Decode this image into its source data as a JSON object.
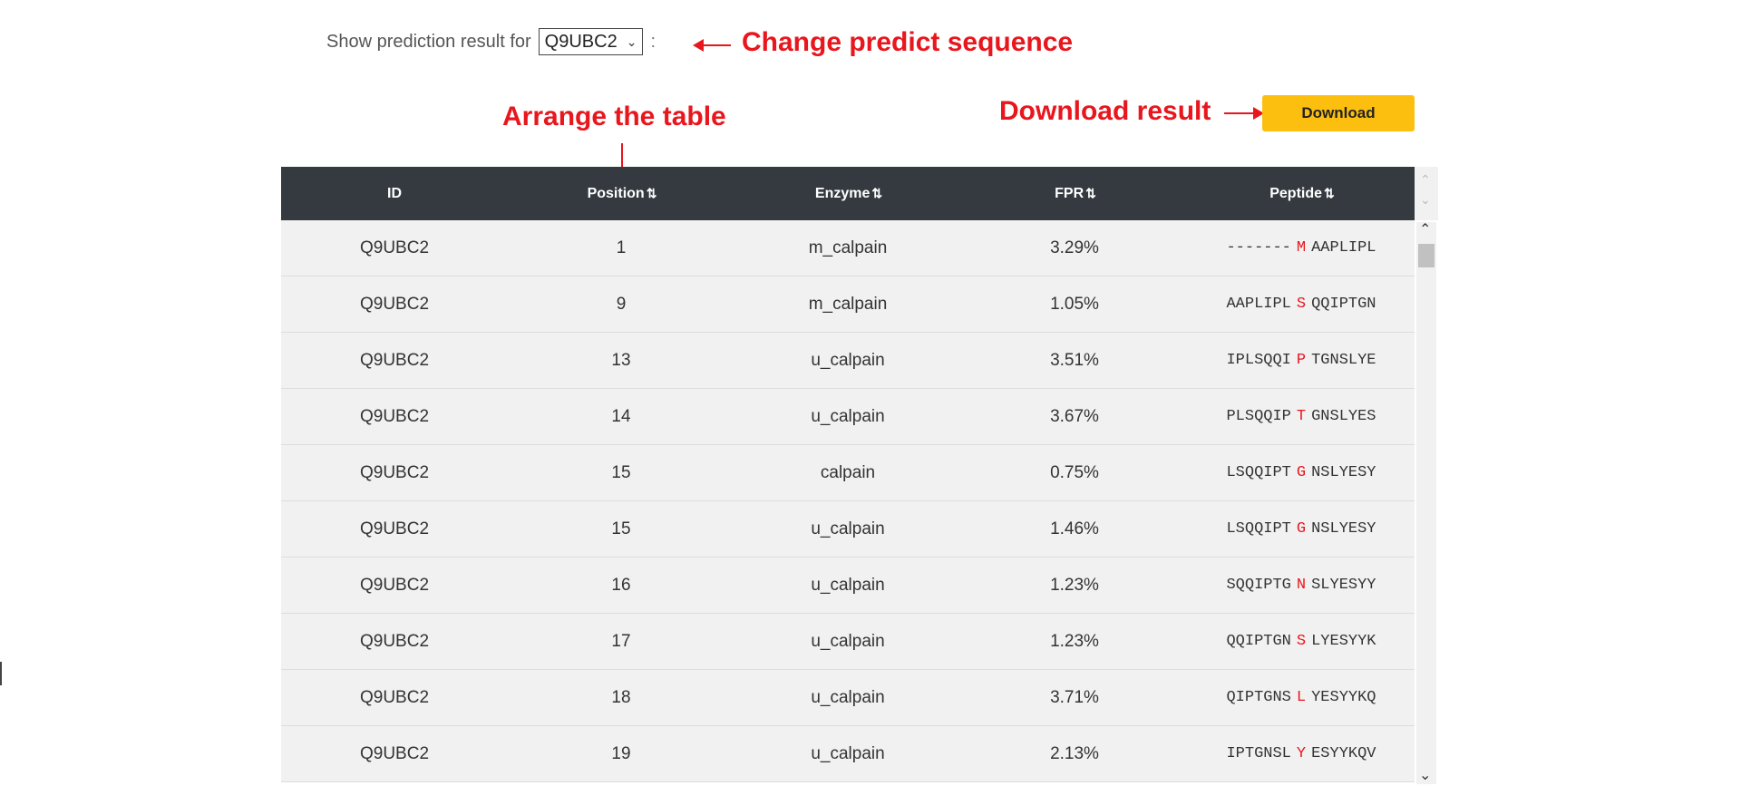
{
  "selector": {
    "label": "Show prediction result for",
    "value": "Q9UBC2",
    "colon": ":"
  },
  "annotations": {
    "change_sequence": "Change predict sequence",
    "arrange_table": "Arrange the table",
    "download_result": "Download result"
  },
  "download_button": {
    "label": "Download",
    "color": "#fdbf0f"
  },
  "table": {
    "headers": [
      {
        "label": "ID",
        "sortable": false
      },
      {
        "label": "Position",
        "sortable": true
      },
      {
        "label": "Enzyme",
        "sortable": true
      },
      {
        "label": "FPR",
        "sortable": true
      },
      {
        "label": "Peptide",
        "sortable": true
      }
    ],
    "sort_icon": "⇅",
    "rows": [
      {
        "id": "Q9UBC2",
        "position": "1",
        "enzyme": "m_calpain",
        "fpr": "3.29%",
        "pep_pre": "-------",
        "pep_site": "M",
        "pep_post": "AAPLIPL"
      },
      {
        "id": "Q9UBC2",
        "position": "9",
        "enzyme": "m_calpain",
        "fpr": "1.05%",
        "pep_pre": "AAPLIPL",
        "pep_site": "S",
        "pep_post": "QQIPTGN"
      },
      {
        "id": "Q9UBC2",
        "position": "13",
        "enzyme": "u_calpain",
        "fpr": "3.51%",
        "pep_pre": "IPLSQQI",
        "pep_site": "P",
        "pep_post": "TGNSLYE"
      },
      {
        "id": "Q9UBC2",
        "position": "14",
        "enzyme": "u_calpain",
        "fpr": "3.67%",
        "pep_pre": "PLSQQIP",
        "pep_site": "T",
        "pep_post": "GNSLYES"
      },
      {
        "id": "Q9UBC2",
        "position": "15",
        "enzyme": "calpain",
        "fpr": "0.75%",
        "pep_pre": "LSQQIPT",
        "pep_site": "G",
        "pep_post": "NSLYESY"
      },
      {
        "id": "Q9UBC2",
        "position": "15",
        "enzyme": "u_calpain",
        "fpr": "1.46%",
        "pep_pre": "LSQQIPT",
        "pep_site": "G",
        "pep_post": "NSLYESY"
      },
      {
        "id": "Q9UBC2",
        "position": "16",
        "enzyme": "u_calpain",
        "fpr": "1.23%",
        "pep_pre": "SQQIPTG",
        "pep_site": "N",
        "pep_post": "SLYESYY"
      },
      {
        "id": "Q9UBC2",
        "position": "17",
        "enzyme": "u_calpain",
        "fpr": "1.23%",
        "pep_pre": "QQIPTGN",
        "pep_site": "S",
        "pep_post": "LYESYYK"
      },
      {
        "id": "Q9UBC2",
        "position": "18",
        "enzyme": "u_calpain",
        "fpr": "3.71%",
        "pep_pre": "QIPTGNS",
        "pep_site": "L",
        "pep_post": "YESYYKQ"
      },
      {
        "id": "Q9UBC2",
        "position": "19",
        "enzyme": "u_calpain",
        "fpr": "2.13%",
        "pep_pre": "IPTGNSL",
        "pep_site": "Y",
        "pep_post": "ESYYKQV"
      }
    ]
  },
  "colors": {
    "header_bg": "#343a40",
    "row_bg": "#f1f1f1",
    "annotation_red": "#e8161d"
  }
}
